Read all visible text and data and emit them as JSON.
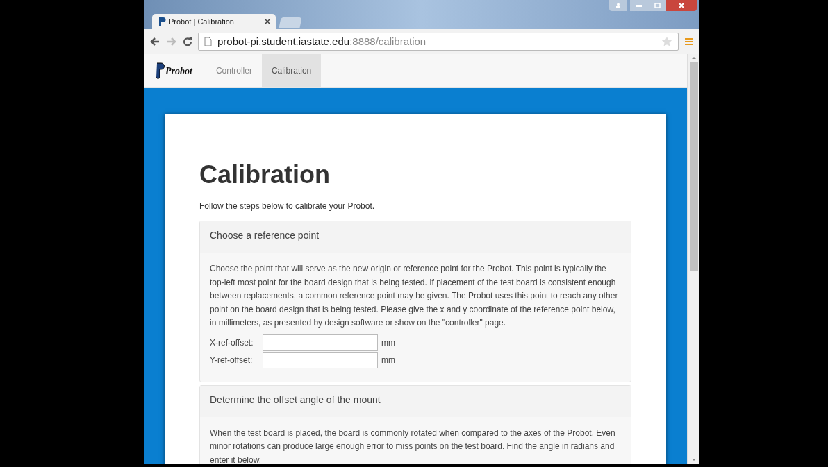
{
  "browser": {
    "tab_title": "Probot | Calibration",
    "url_host": "probot-pi.student.iastate.edu",
    "url_path": ":8888/calibration"
  },
  "navbar": {
    "brand": "Probot",
    "items": [
      {
        "label": "Controller",
        "selected": false
      },
      {
        "label": "Calibration",
        "selected": true
      }
    ]
  },
  "page": {
    "title": "Calibration",
    "intro": "Follow the steps below to calibrate your Probot.",
    "sections": [
      {
        "title": "Choose a reference point",
        "text": "Choose the point that will serve as the new origin or reference point for the Probot. This point is typically the top-left most point for the board design that is being tested. If placement of the test board is consistent enough between replacements, a common reference point may be given. The Probot uses this point to reach any other point on the board design that is being tested. Please give the x and y coordinate of the reference point below, in millimeters, as presented by design software or show on the \"controller\" page.",
        "fields": [
          {
            "label": "X-ref-offset:",
            "unit": "mm"
          },
          {
            "label": "Y-ref-offset:",
            "unit": "mm"
          }
        ]
      },
      {
        "title": "Determine the offset angle of the mount",
        "text": "When the test board is placed, the board is commonly rotated when compared to the axes of the Probot. Even minor rotations can produce large enough error to miss points on the test board. Find the angle in radians and enter it below."
      }
    ]
  }
}
